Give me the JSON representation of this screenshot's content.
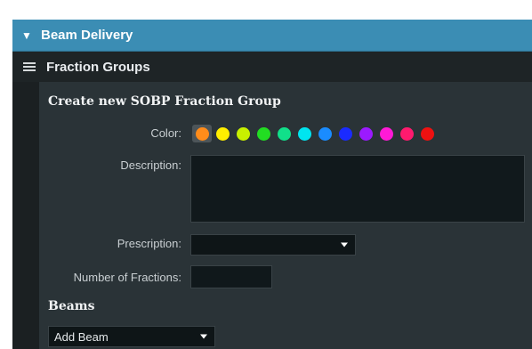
{
  "beam_delivery": {
    "title": "Beam Delivery",
    "expanded_icon": "triangle-down-icon"
  },
  "fraction_groups": {
    "title": "Fraction Groups",
    "menu_icon": "hamburger-icon"
  },
  "create_form": {
    "title": "Create new SOBP Fraction Group",
    "color_label": "Color:",
    "colors": [
      "#ff8c1a",
      "#ffee00",
      "#c8f000",
      "#22dd22",
      "#11e08a",
      "#00e5f0",
      "#1a8cff",
      "#1a2bff",
      "#9b1aff",
      "#ff1ad6",
      "#ff1a6e",
      "#ee1111"
    ],
    "selected_color_index": 0,
    "description_label": "Description:",
    "description_value": "",
    "prescription_label": "Prescription:",
    "prescription_value": "",
    "fractions_label": "Number of Fractions:",
    "fractions_value": "",
    "beams_title": "Beams",
    "add_beam_label": "Add Beam"
  }
}
